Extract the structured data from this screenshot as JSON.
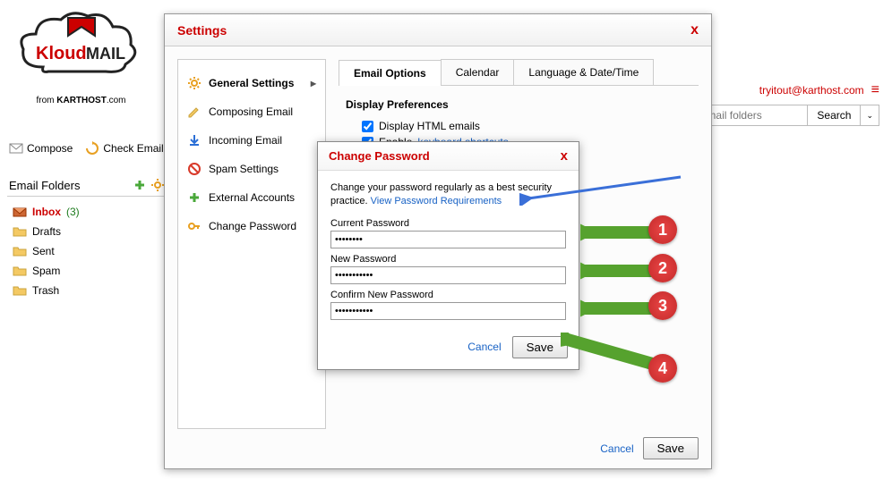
{
  "logo": {
    "brand1": "Kloud",
    "brand2": "MAIL",
    "tag_from": "from",
    "tag_host": "KARTHOST",
    "tag_dom": ".com"
  },
  "top_actions": {
    "compose": "Compose",
    "check": "Check Email"
  },
  "folders": {
    "header": "Email Folders",
    "inbox": "Inbox",
    "inbox_count": "(3)",
    "drafts": "Drafts",
    "sent": "Sent",
    "spam": "Spam",
    "trash": "Trash"
  },
  "topbar": {
    "email": "tryitout@karthost.com"
  },
  "search": {
    "placeholder": "mail folders",
    "button": "Search"
  },
  "settings": {
    "title": "Settings",
    "nav": {
      "general": "General Settings",
      "composing": "Composing Email",
      "incoming": "Incoming Email",
      "spam": "Spam Settings",
      "external": "External Accounts",
      "change_pw": "Change Password"
    },
    "tabs": {
      "email_options": "Email Options",
      "calendar": "Calendar",
      "lang": "Language & Date/Time"
    },
    "prefs": {
      "header": "Display Preferences",
      "html": "Display HTML emails",
      "kb1": "Enable ",
      "kb2": "keyboard shortcuts"
    },
    "cancel": "Cancel",
    "save": "Save"
  },
  "pw": {
    "title": "Change Password",
    "desc1": "Change your password regularly as a best security practice. ",
    "link": "View Password Requirements",
    "current": "Current Password",
    "new": "New Password",
    "confirm": "Confirm New Password",
    "val1": "••••••••",
    "val2": "•••••••••••",
    "val3": "•••••••••••",
    "cancel": "Cancel",
    "save": "Save"
  },
  "anno": {
    "b1": "1",
    "b2": "2",
    "b3": "3",
    "b4": "4"
  }
}
